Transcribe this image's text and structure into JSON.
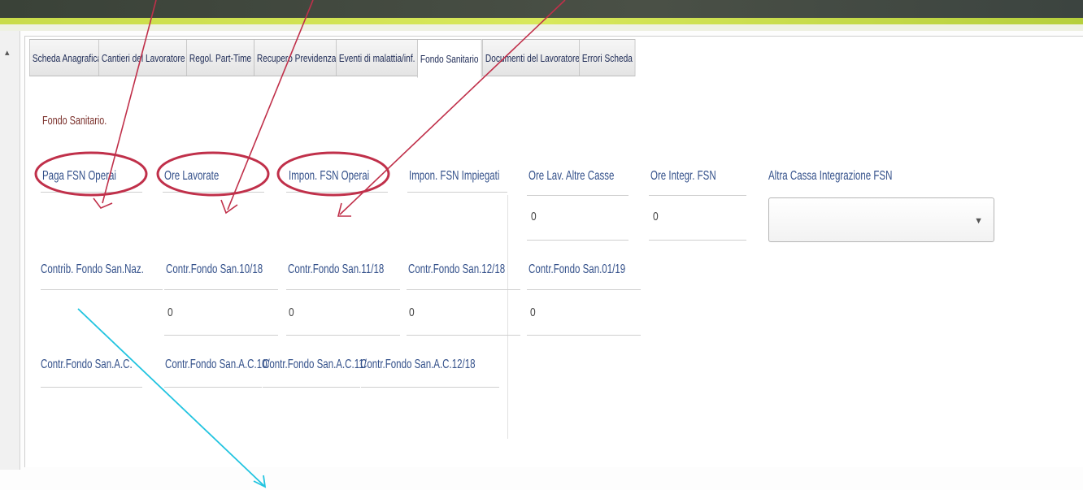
{
  "tabs": [
    {
      "label": "Scheda Anagrafica",
      "active": false
    },
    {
      "label": "Cantieri del Lavoratore",
      "active": false
    },
    {
      "label": "Regol. Part-Time",
      "active": false
    },
    {
      "label": "Recupero Previdenza",
      "active": false
    },
    {
      "label": "Eventi di malattia/inf.",
      "active": false
    },
    {
      "label": "Fondo Sanitario",
      "active": true
    },
    {
      "label": "Documenti del Lavoratore",
      "active": false
    },
    {
      "label": "Errori Scheda",
      "active": false
    }
  ],
  "section_title": "Fondo Sanitario.",
  "row1": {
    "paga_fsn_operai": "Paga FSN Operai",
    "ore_lavorate": "Ore Lavorate",
    "impon_fsn_operai": "Impon. FSN Operai",
    "impon_fsn_impiegati": "Impon. FSN Impiegati",
    "ore_lav_altre_casse": "Ore Lav. Altre Casse",
    "ore_integr_fsn": "Ore Integr. FSN",
    "altra_cassa": "Altra Cassa Integrazione FSN",
    "ore_lav_altre_casse_value": "0",
    "ore_integr_fsn_value": "0",
    "altra_cassa_selected": ""
  },
  "row2": {
    "contrib_fondo_naz": "Contrib. Fondo San.Naz.",
    "contr_10_18": "Contr.Fondo San.10/18",
    "contr_11_18": "Contr.Fondo San.11/18",
    "contr_12_18": "Contr.Fondo San.12/18",
    "contr_01_19": "Contr.Fondo San.01/19",
    "contr_10_18_value": "0",
    "contr_11_18_value": "0",
    "contr_12_18_value": "0",
    "contr_01_19_value": "0"
  },
  "row3": {
    "contr_ac": "Contr.Fondo San.A.C.",
    "contr_ac_10": "Contr.Fondo San.A.C.10/",
    "contr_ac_11": "Contr.Fondo San.A.C.11/",
    "contr_ac_12": "Contr.Fondo San.A.C.12/18"
  },
  "icons": {
    "left_arrow": "up-arrow-icon",
    "dropdown": "triangle-down-icon"
  },
  "colors": {
    "label_blue": "#33508a",
    "title_red": "#7a2f2a",
    "annotation_red": "#c0304a",
    "annotation_cyan": "#22c4e0",
    "accent_green": "#d2e454"
  }
}
